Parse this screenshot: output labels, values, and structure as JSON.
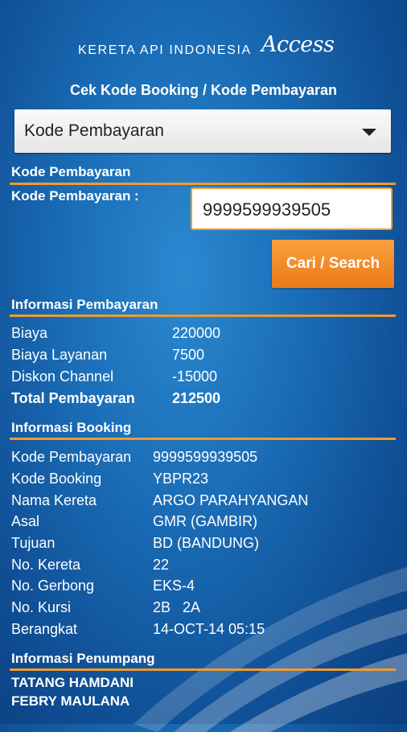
{
  "brand": {
    "text": "KERETA API INDONESIA",
    "access": "Access"
  },
  "page_title": "Cek Kode Booking / Kode Pembayaran",
  "search_type": {
    "selected": "Kode Pembayaran"
  },
  "search": {
    "section_title": "Kode Pembayaran",
    "field_label": "Kode Pembayaran :",
    "value": "9999599939505",
    "button_label": "Cari / Search"
  },
  "payment": {
    "title": "Informasi Pembayaran",
    "rows": [
      {
        "label": "Biaya",
        "value": "220000"
      },
      {
        "label": "Biaya Layanan",
        "value": "7500"
      },
      {
        "label": "Diskon Channel",
        "value": "-15000"
      },
      {
        "label": "Total Pembayaran",
        "value": "212500"
      }
    ]
  },
  "booking": {
    "title": "Informasi Booking",
    "rows": [
      {
        "label": "Kode Pembayaran",
        "value": "9999599939505"
      },
      {
        "label": "Kode Booking",
        "value": "YBPR23"
      },
      {
        "label": "Nama Kereta",
        "value": "ARGO PARAHYANGAN"
      },
      {
        "label": "Asal",
        "value": "GMR (GAMBIR)"
      },
      {
        "label": "Tujuan",
        "value": "BD (BANDUNG)"
      },
      {
        "label": "No. Kereta",
        "value": "22"
      },
      {
        "label": "No. Gerbong",
        "value": "EKS-4"
      },
      {
        "label": "No. Kursi",
        "value": "2B   2A"
      },
      {
        "label": "Berangkat",
        "value": "14-OCT-14 05:15"
      }
    ]
  },
  "passengers": {
    "title": "Informasi Penumpang",
    "names": [
      "TATANG HAMDANI",
      "FEBRY MAULANA"
    ]
  },
  "colors": {
    "accent": "#f29a2e",
    "background": "#1a6cb6",
    "button": "#ee8320"
  }
}
